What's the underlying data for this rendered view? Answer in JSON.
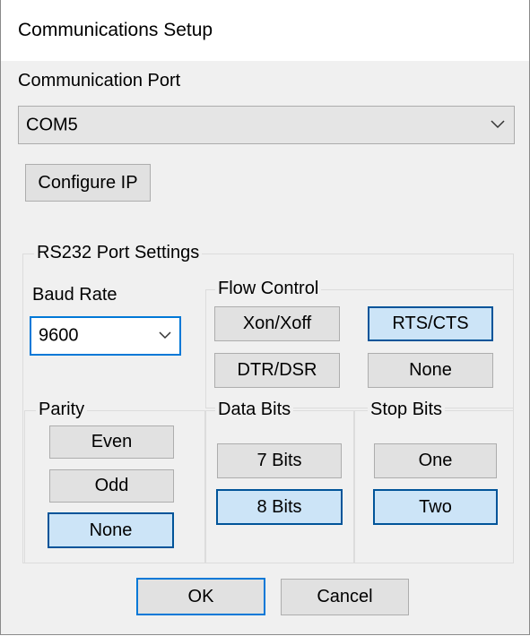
{
  "window": {
    "title": "Communications Setup"
  },
  "port": {
    "label": "Communication Port",
    "value": "COM5",
    "configure_ip": "Configure IP"
  },
  "rs232": {
    "group_label": "RS232 Port Settings",
    "baud": {
      "label": "Baud Rate",
      "value": "9600"
    },
    "flow": {
      "label": "Flow Control",
      "options": [
        "Xon/Xoff",
        "RTS/CTS",
        "DTR/DSR",
        "None"
      ],
      "selected": "RTS/CTS"
    },
    "parity": {
      "label": "Parity",
      "options": [
        "Even",
        "Odd",
        "None"
      ],
      "selected": "None"
    },
    "data_bits": {
      "label": "Data Bits",
      "options": [
        "7 Bits",
        "8 Bits"
      ],
      "selected": "8 Bits"
    },
    "stop_bits": {
      "label": "Stop Bits",
      "options": [
        "One",
        "Two"
      ],
      "selected": "Two"
    }
  },
  "footer": {
    "ok": "OK",
    "cancel": "Cancel"
  },
  "colors": {
    "selected_fill": "#cce4f7",
    "selected_border": "#005499",
    "accent": "#0078d7"
  }
}
